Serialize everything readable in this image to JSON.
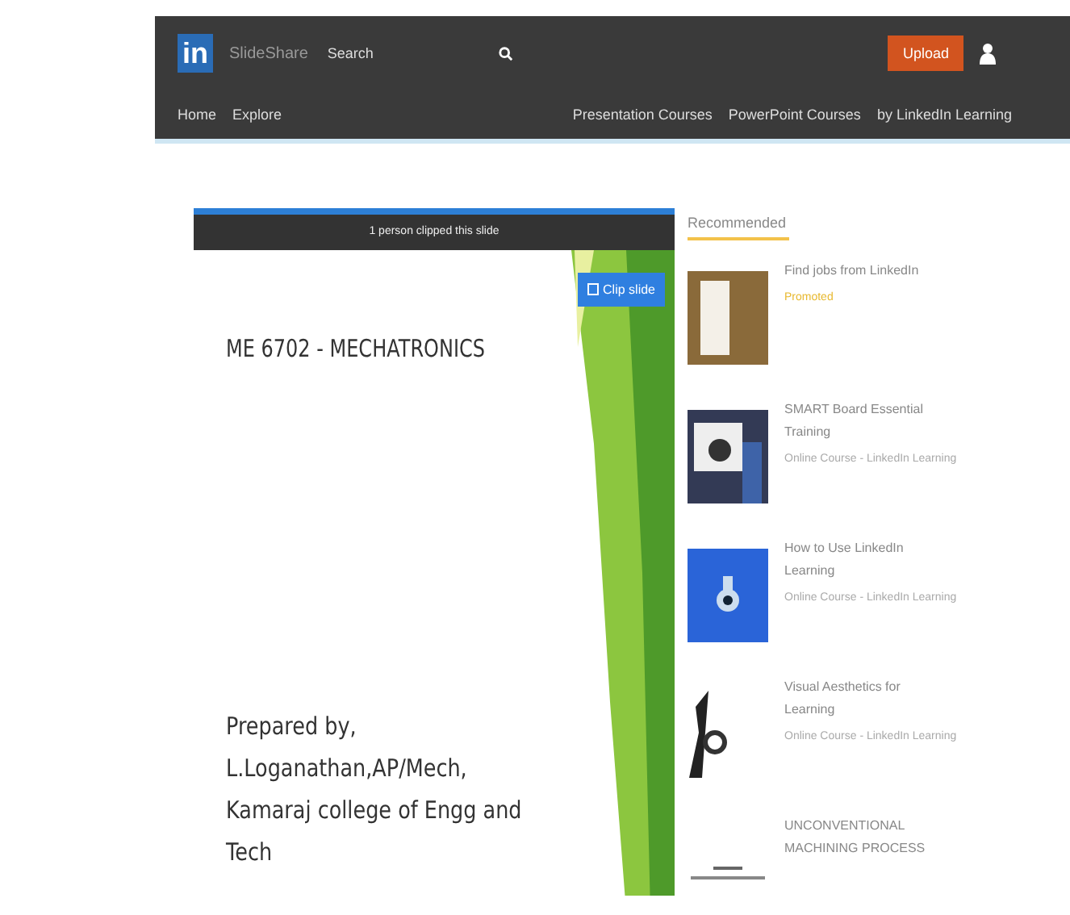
{
  "header": {
    "logo": "in",
    "brand": "SlideShare",
    "search": {
      "placeholder": "Search"
    },
    "upload_button": "Upload",
    "nav_left": [
      "Home",
      "Explore"
    ],
    "nav_right": [
      "Presentation Courses",
      "PowerPoint Courses",
      "by LinkedIn Learning"
    ]
  },
  "slide": {
    "clip_notice": "1 person clipped this slide",
    "clip_button": "Clip slide",
    "title": "ME 6702 - MECHATRONICS",
    "author_lines": [
      "Prepared by,",
      "L.Loganathan,AP/Mech,",
      "Kamaraj college of Engg and",
      "Tech"
    ]
  },
  "recommended": {
    "heading": "Recommended",
    "items": [
      {
        "kind": "photo",
        "title": "Find jobs from LinkedIn",
        "label": "Promoted"
      },
      {
        "kind": "video",
        "title": "SMART Board Essential Training",
        "subtitle": "Online Course - LinkedIn Learning"
      },
      {
        "kind": "blue",
        "title": "How to Use LinkedIn Learning",
        "subtitle": "Online Course - LinkedIn Learning"
      },
      {
        "kind": "figure",
        "title": "Visual Aesthetics for Learning",
        "subtitle": "Online Course - LinkedIn Learning"
      },
      {
        "kind": "text",
        "title": "UNCONVENTIONAL MACHINING PROCESS"
      }
    ]
  }
}
